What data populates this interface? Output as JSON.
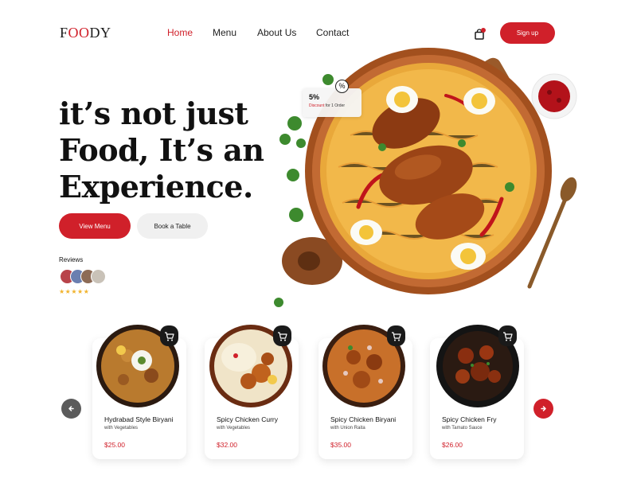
{
  "brand": {
    "logo_prefix": "F",
    "logo_accent": "OO",
    "logo_suffix": "DY"
  },
  "nav": {
    "items": [
      "Home",
      "Menu",
      "About Us",
      "Contact"
    ],
    "active": "Home"
  },
  "header": {
    "signup_label": "Sign up",
    "cart_icon": "shopping-bag-icon"
  },
  "hero": {
    "headline_lines": [
      "it’s not just",
      "Food, It’s an",
      "Experience."
    ],
    "view_menu_label": "View Menu",
    "book_table_label": "Book a Table",
    "reviews_label": "Reviews",
    "rating_stars": 5
  },
  "discount": {
    "percent": "5%",
    "text_red": "Discount",
    "text_rest": " for 1 Order",
    "icon": "percent-icon"
  },
  "dishes": [
    {
      "title": "Hydrabad Style Biryani",
      "subtitle": "with Vegetables",
      "price": "$25.00"
    },
    {
      "title": "Spicy Chicken Curry",
      "subtitle": "with Vegetables",
      "price": "$32.00"
    },
    {
      "title": "Spicy Chicken Biryani",
      "subtitle": "with Union Raita",
      "price": "$35.00"
    },
    {
      "title": "Spicy Chicken Fry",
      "subtitle": "with Tamato Sauce",
      "price": "$26.00"
    }
  ],
  "colors": {
    "accent": "#d0202a",
    "dark": "#1a1a1a",
    "star": "#f1b32c",
    "arrow_left": "#5b5b5b"
  }
}
